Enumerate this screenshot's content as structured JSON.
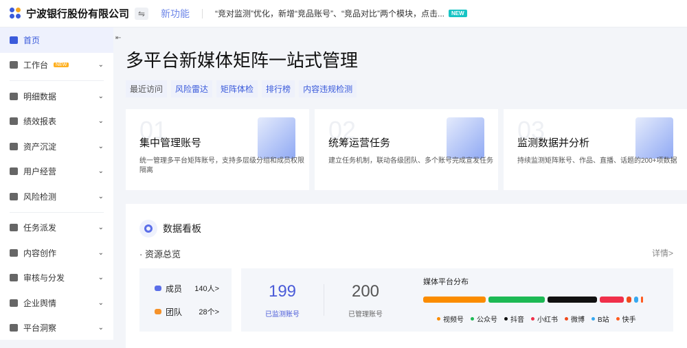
{
  "header": {
    "company": "宁波银行股份有限公司",
    "switch_icon": "⇋",
    "new_features": "新功能",
    "notice": "“竞对监测”优化，新增“竞品账号”、“竞品对比”两个模块，点击...",
    "new_badge": "NEW"
  },
  "sidebar": {
    "items": [
      {
        "label": "首页",
        "active": true
      },
      {
        "label": "工作台",
        "badge": "NEW",
        "chevron": "⌄"
      },
      {
        "label": "明细数据",
        "chevron": "⌄"
      },
      {
        "label": "绩效报表",
        "chevron": "⌄"
      },
      {
        "label": "资产沉淀",
        "chevron": "⌄"
      },
      {
        "label": "用户经营",
        "chevron": "⌄"
      },
      {
        "label": "风险检测",
        "chevron": "⌄"
      },
      {
        "label": "任务派发",
        "chevron": "⌄"
      },
      {
        "label": "内容创作",
        "chevron": "⌄"
      },
      {
        "label": "审核与分发",
        "chevron": "⌄"
      },
      {
        "label": "企业舆情",
        "chevron": "⌄"
      },
      {
        "label": "平台洞察",
        "chevron": "⌄"
      }
    ]
  },
  "main": {
    "title": "多平台新媒体矩阵一站式管理",
    "recent_label": "最近访问",
    "recent": [
      "风险雷达",
      "矩阵体检",
      "排行榜",
      "内容违规检测"
    ],
    "cards": [
      {
        "num": "01",
        "title": "集中管理账号",
        "desc": "统一管理多平台矩阵账号，支持多层级分组和成员权限隔离"
      },
      {
        "num": "02",
        "title": "统筹运营任务",
        "desc": "建立任务机制，联动各级团队、多个账号完成宣发任务"
      },
      {
        "num": "03",
        "title": "监测数据并分析",
        "desc": "持续监测矩阵账号、作品、直播、话题的200+项数据"
      }
    ]
  },
  "dashboard": {
    "title": "数据看板",
    "section": "资源总览",
    "more": "详情>",
    "members_label": "成员",
    "members_value": "140人>",
    "teams_label": "团队",
    "teams_value": "28个>",
    "monitored": "199",
    "monitored_label": "已监测账号",
    "managed": "200",
    "managed_label": "已管理账号",
    "dist_title": "媒体平台分布",
    "platforms": [
      {
        "name": "视频号",
        "color": "#fb8c00",
        "value": 90
      },
      {
        "name": "公众号",
        "color": "#1db954",
        "value": 82
      },
      {
        "name": "抖音",
        "color": "#111111",
        "value": 71
      },
      {
        "name": "小红书",
        "color": "#f0304a",
        "value": 35
      },
      {
        "name": "微博",
        "color": "#f04a1c",
        "value": 7
      },
      {
        "name": "B站",
        "color": "#36a8f0",
        "value": 6
      },
      {
        "name": "快手",
        "color": "#ff5a1f",
        "value": 2
      }
    ]
  }
}
